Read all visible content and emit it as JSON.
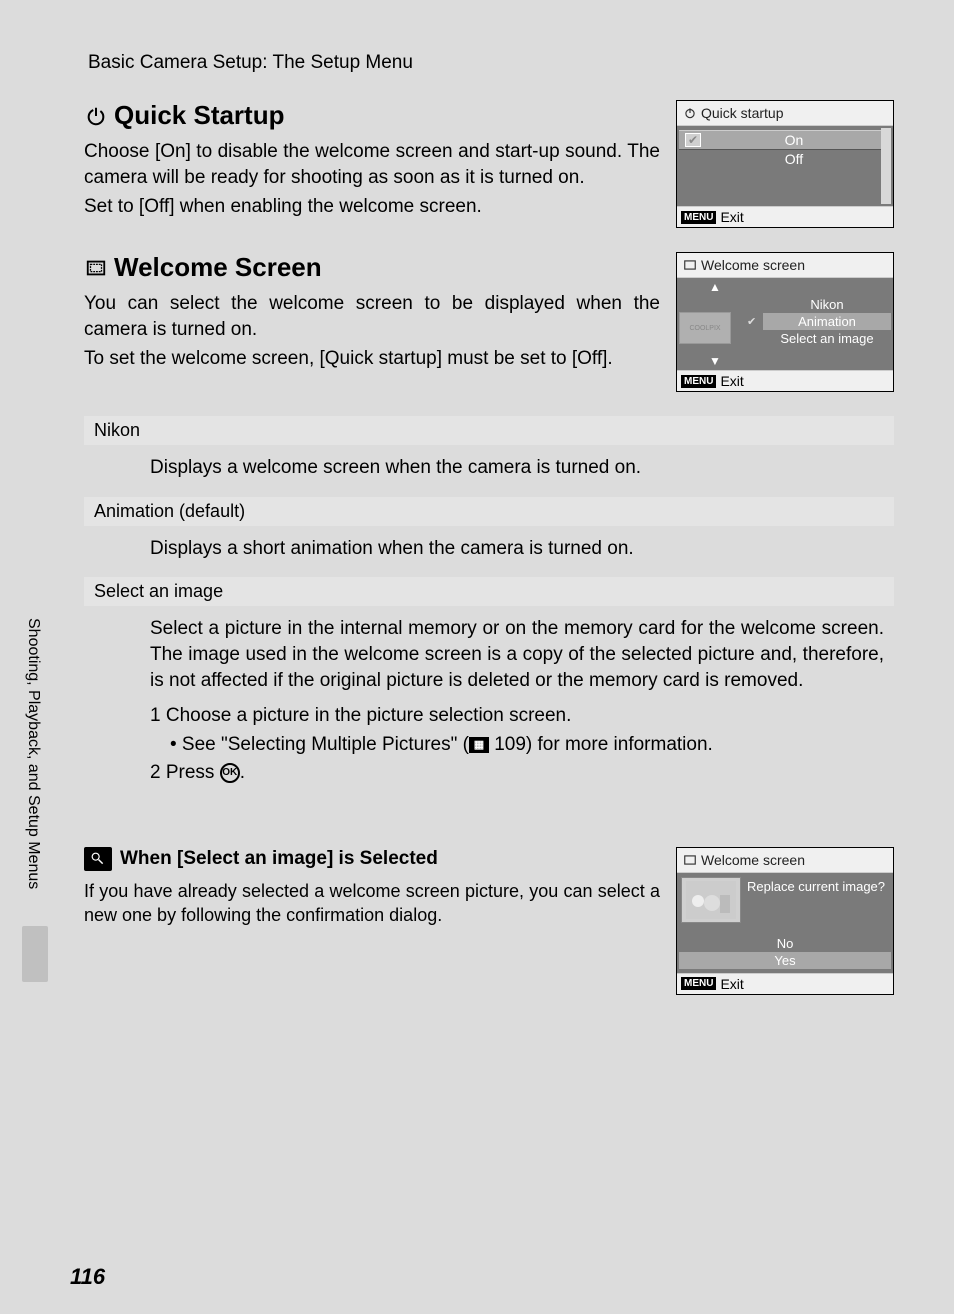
{
  "breadcrumb": "Basic Camera Setup: The Setup Menu",
  "sideTabLabel": "Shooting, Playback, and Setup Menus",
  "pageNumber": "116",
  "quickStartup": {
    "heading": "Quick Startup",
    "para1": "Choose [On] to disable the welcome screen and start-up sound. The camera will be ready for shooting as soon as it is turned on.",
    "para2": "Set to [Off] when enabling the welcome screen.",
    "lcd": {
      "title": "Quick startup",
      "optOn": "On",
      "optOff": "Off",
      "exit": "Exit"
    }
  },
  "welcomeScreen": {
    "heading": "Welcome Screen",
    "para1": "You can select the welcome screen to be displayed when the camera is turned on.",
    "para2": "To set the welcome screen, [Quick startup] must be set to [Off].",
    "lcd": {
      "title": "Welcome screen",
      "optNikon": "Nikon",
      "optAnim": "Animation",
      "optSelect": "Select an image",
      "exit": "Exit",
      "thumbLabel": "COOLPIX"
    },
    "options": {
      "nikon": {
        "label": "Nikon",
        "desc": "Displays a welcome screen when the camera is turned on."
      },
      "animation": {
        "label": "Animation (default)",
        "desc": "Displays a short animation when the camera is turned on."
      },
      "selectImage": {
        "label": "Select an image",
        "desc": "Select a picture in the internal memory or on the memory card for the welcome screen. The image used in the welcome screen is a copy of the selected picture and, therefore, is not affected if the original picture is deleted or the memory card is removed.",
        "step1": "1  Choose a picture in the picture selection screen.",
        "step1b": "• See \"Selecting Multiple Pictures\" (",
        "step1c": " 109) for more information.",
        "step2": "2  Press "
      }
    }
  },
  "note": {
    "heading": "When [Select an image] is Selected",
    "para": "If you have already selected a welcome screen picture, you can select a new one by following the confirmation dialog.",
    "lcd": {
      "title": "Welcome screen",
      "prompt": "Replace current image?",
      "optNo": "No",
      "optYes": "Yes",
      "exit": "Exit"
    }
  },
  "labels": {
    "menuBadge": "MENU",
    "okBadge": "OK"
  }
}
